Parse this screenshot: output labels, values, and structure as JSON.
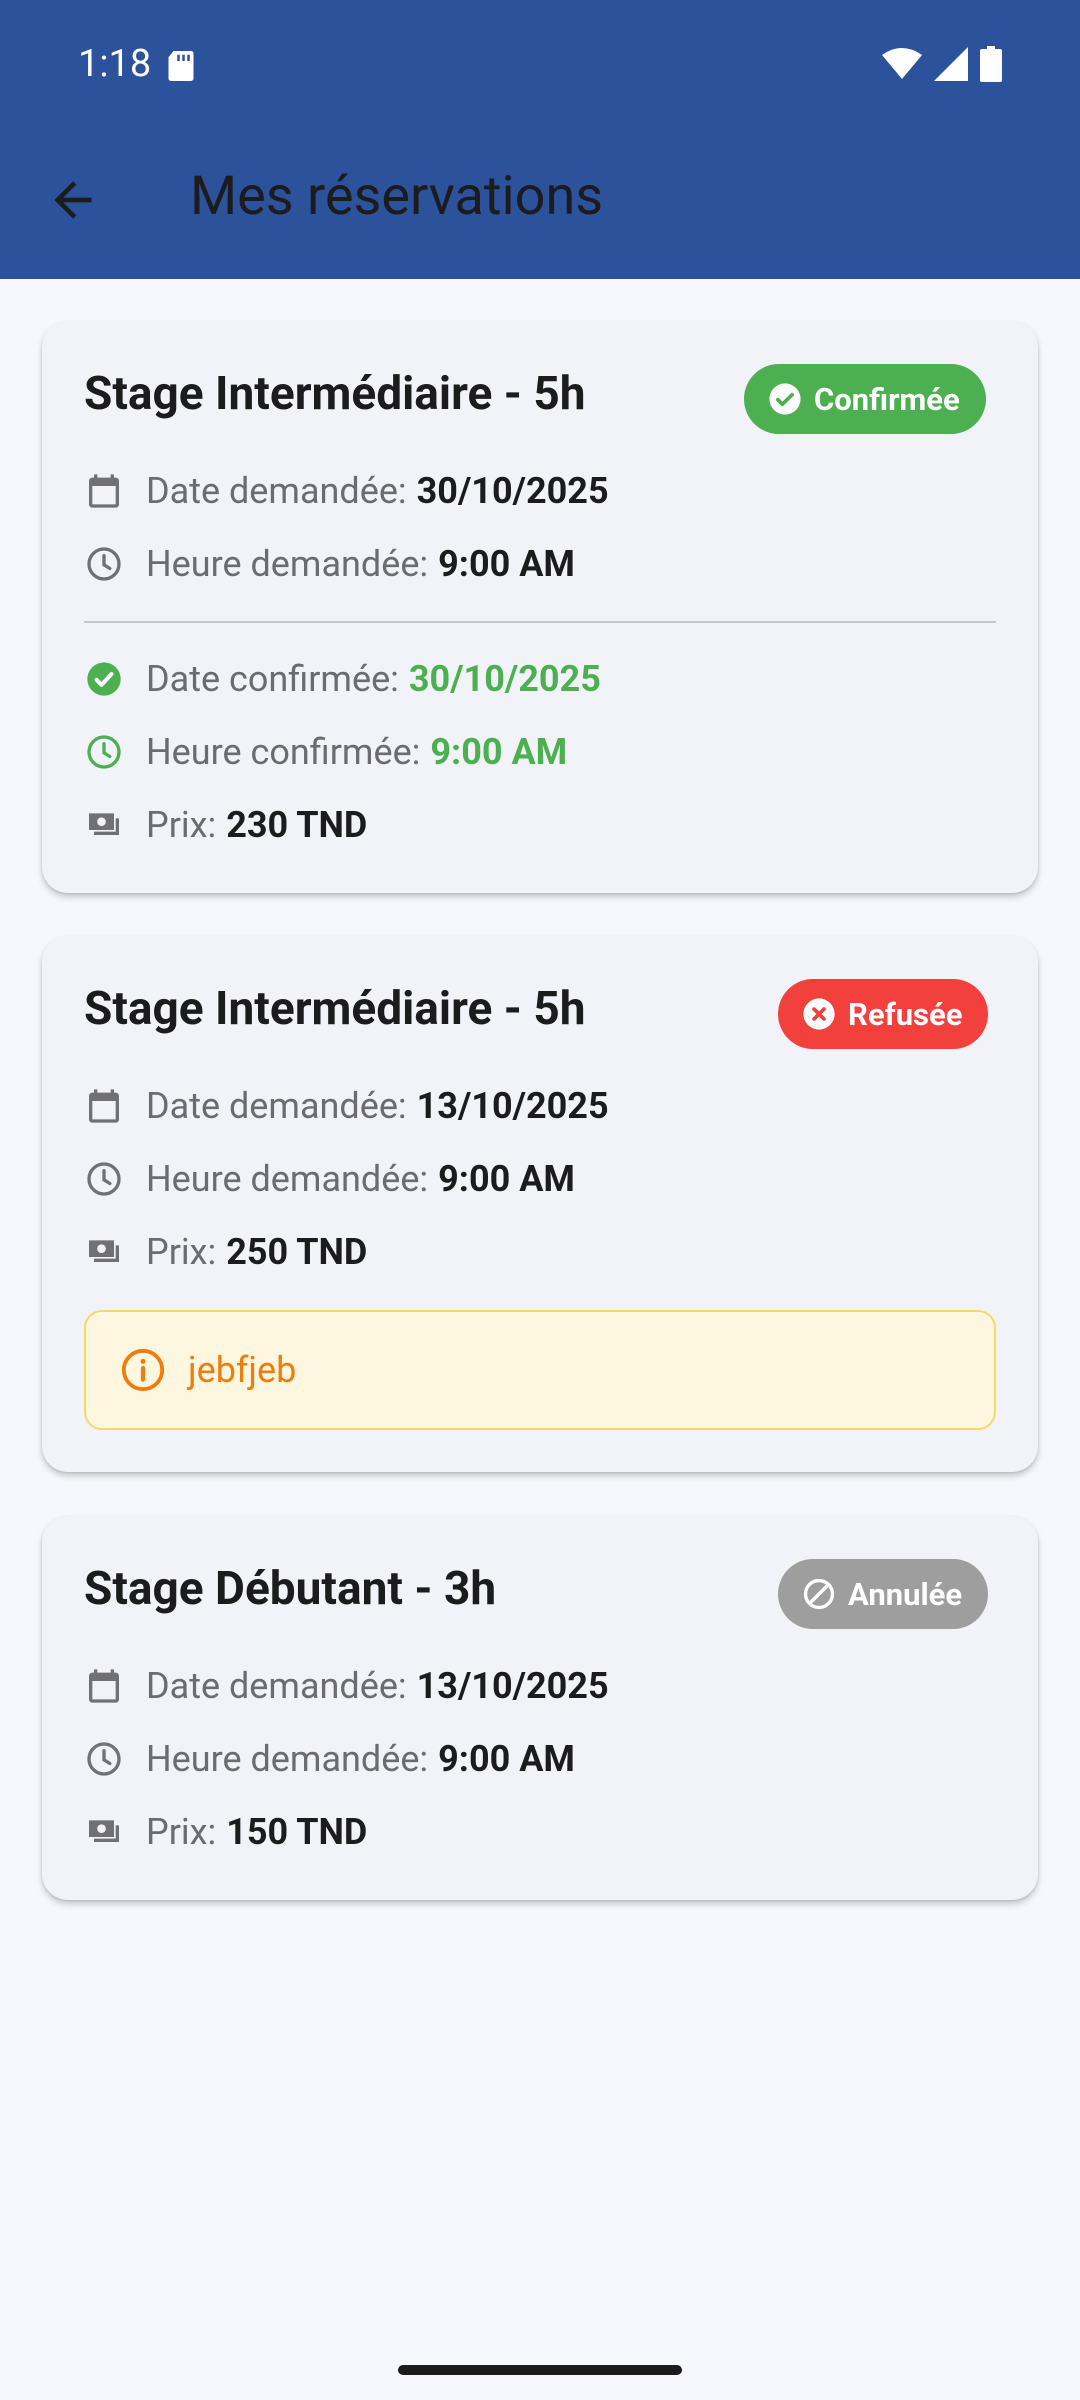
{
  "status_bar": {
    "time": "1:18"
  },
  "header": {
    "title": "Mes réservations"
  },
  "reservations": [
    {
      "title": "Stage Intermédiaire - 5h",
      "status": "Confirmée",
      "status_color": "#4caf50",
      "requested_date_label": "Date demandée:",
      "requested_date": "30/10/2025",
      "requested_time_label": "Heure demandée:",
      "requested_time": "9:00 AM",
      "confirmed_date_label": "Date confirmée:",
      "confirmed_date": "30/10/2025",
      "confirmed_time_label": "Heure confirmée:",
      "confirmed_time": "9:00 AM",
      "price_label": "Prix:",
      "price": "230 TND"
    },
    {
      "title": "Stage Intermédiaire - 5h",
      "status": "Refusée",
      "status_color": "#f2413d",
      "requested_date_label": "Date demandée:",
      "requested_date": "13/10/2025",
      "requested_time_label": "Heure demandée:",
      "requested_time": "9:00 AM",
      "price_label": "Prix:",
      "price": "250 TND",
      "note": "jebfjeb"
    },
    {
      "title": "Stage Débutant - 3h",
      "status": "Annulée",
      "status_color": "#9e9e9e",
      "requested_date_label": "Date demandée:",
      "requested_date": "13/10/2025",
      "requested_time_label": "Heure demandée:",
      "requested_time": "9:00 AM",
      "price_label": "Prix:",
      "price": "150 TND"
    }
  ],
  "colors": {
    "primary": "#2b529b",
    "confirmed": "#4caf50",
    "refused": "#f2413d",
    "cancelled": "#9e9e9e",
    "note_text": "#ee7c0e"
  }
}
